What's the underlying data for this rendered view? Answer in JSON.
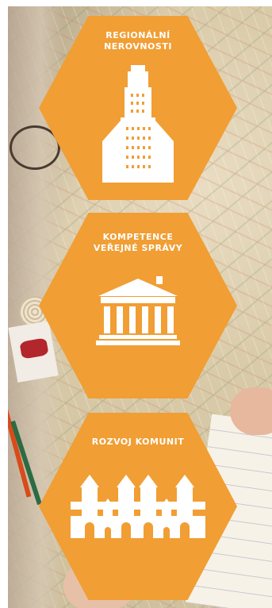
{
  "panels": [
    {
      "title": "REGIONÁLNÍ\nNEROVNOSTI",
      "icon": "skyscraper-icon"
    },
    {
      "title": "KOMPETENCE\nVEŘEJNÉ SPRÁVY",
      "icon": "government-building-icon"
    },
    {
      "title": "ROZVOJ KOMUNIT",
      "icon": "town-skyline-icon"
    }
  ],
  "colors": {
    "hexagon": "#f19e34",
    "icon": "#ffffff"
  }
}
